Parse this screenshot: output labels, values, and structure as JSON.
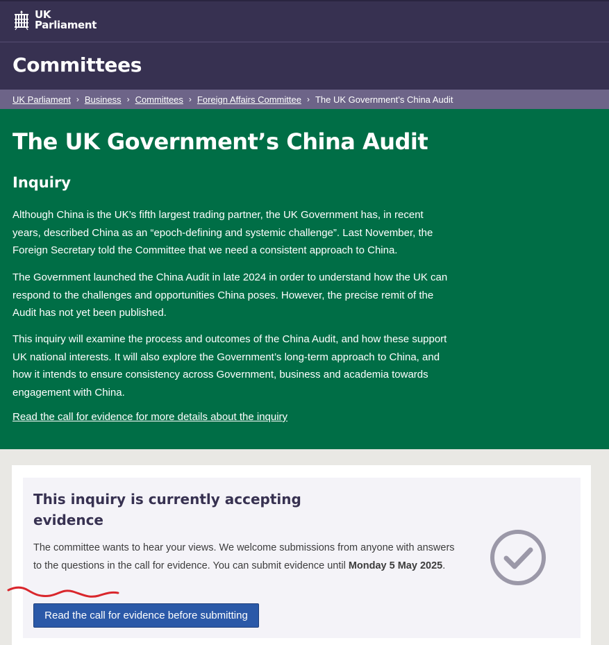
{
  "header": {
    "logo_line1": "UK",
    "logo_line2": "Parliament",
    "logo_icon": "portcullis-icon",
    "section_title": "Committees"
  },
  "breadcrumb": {
    "items": [
      "UK Parliament",
      "Business",
      "Committees",
      "Foreign Affairs Committee"
    ],
    "current": "The UK Government’s China Audit",
    "separator": "›"
  },
  "inquiry": {
    "title": "The UK Government’s China Audit",
    "subtitle": "Inquiry",
    "paragraphs": [
      "Although China is the UK’s fifth largest trading partner, the UK Government has, in recent years, described China as an “epoch-defining and systemic challenge”. Last November, the Foreign Secretary told the Committee that we need a consistent approach to China.",
      "The Government launched the China Audit in late 2024 in order to understand how the UK can respond to the challenges and opportunities China poses. However, the precise remit of the Audit has not yet been published.",
      "This inquiry will examine the process and outcomes of the China Audit, and how these support UK national interests. It will also explore the Government’s long-term approach to China, and how it intends to ensure consistency across Government, business and academia towards engagement with China."
    ],
    "link_text": "Read the call for evidence for more details about the inquiry"
  },
  "evidence_card": {
    "heading": "This inquiry is currently accepting evidence",
    "text": "The committee wants to hear your views. We welcome submissions from anyone with answers to the questions in the call for evidence. You can submit evidence until ",
    "deadline": "Monday 5 May 2025",
    "text_end": ".",
    "button_label": "Read the call for evidence before submitting",
    "status_icon": "check-circle-icon"
  },
  "colors": {
    "header_bg": "#373151",
    "breadcrumb_bg": "#6d6488",
    "hero_bg": "#006e46",
    "button_bg": "#2b59a8",
    "annotation": "#d9262c"
  }
}
